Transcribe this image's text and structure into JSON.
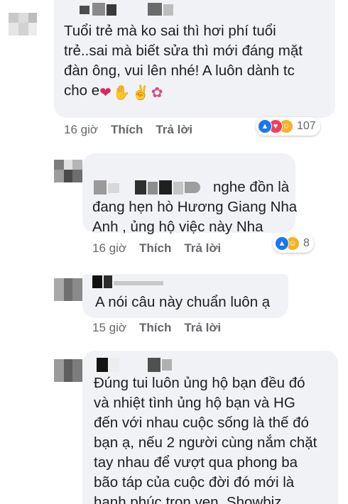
{
  "comments": [
    {
      "text_lines": [
        "Tuổi trẻ mà ko sai thì hơi phí tuổi",
        "trẻ..sai mà biết sửa thì mới đáng mặt",
        "đàn ông, vui lên nhé! A luôn dành tc",
        "cho e"
      ],
      "emojis": [
        "heart-emoji",
        "clapping-hands-emoji",
        "ok-hand-emoji",
        "bouquet-emoji"
      ],
      "time": "16 giờ",
      "like_label": "Thích",
      "reply_label": "Trả lời",
      "reaction_icons": [
        "like",
        "love",
        "haha"
      ],
      "reaction_count": "107"
    },
    {
      "text_lines": [
        "nghe đồn là",
        "đang hẹn hò Hương Giang Nha",
        "Anh , ủng hộ việc này Nha"
      ],
      "time": "16 giờ",
      "like_label": "Thích",
      "reply_label": "Trả lời",
      "reaction_icons": [
        "like",
        "haha"
      ],
      "reaction_count": "8"
    },
    {
      "text_lines": [
        "A nói câu này chuẩn luôn ạ"
      ],
      "time": "15 giờ",
      "like_label": "Thích",
      "reply_label": "Trả lời"
    },
    {
      "text_lines": [
        "Đúng tui luôn ủng hộ bạn đều đó",
        "và nhiệt tình ủng hộ bạn và HG",
        "đến với nhau cuộc sống là thế đó",
        "bạn ạ, nếu 2 người cùng nắm chặt",
        "tay nhau để vượt qua phong ba",
        "bão táp của cuộc đời đó mới là",
        "hạnh phúc trọn vẹn. Showbiz"
      ]
    }
  ],
  "colors": {
    "bubble_bg": "#f0f2f5",
    "text": "#1c1e21",
    "meta": "#65676b",
    "like_blue": "#1877f2",
    "love_red": "#f33e58",
    "haha_yellow": "#f7b125"
  }
}
